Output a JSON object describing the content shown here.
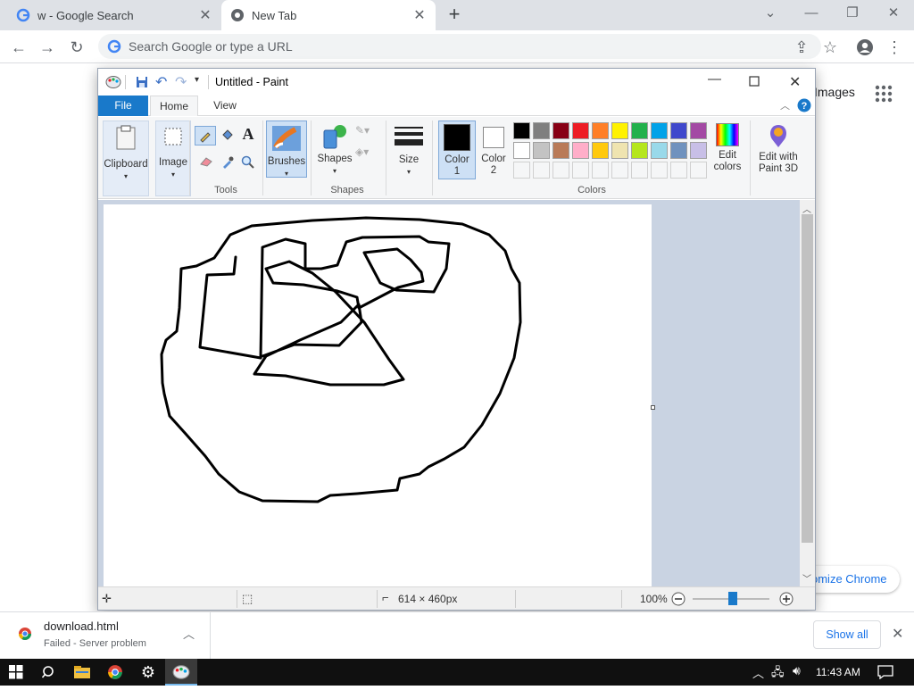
{
  "chrome": {
    "tabs": [
      {
        "title": "w - Google Search",
        "active": false
      },
      {
        "title": "New Tab",
        "active": true
      }
    ],
    "omnibox_placeholder": "Search Google or type a URL",
    "images_link": "Images",
    "customize_label": "Customize Chrome",
    "customize_visible": "omize Chrome"
  },
  "paint": {
    "title": "Untitled - Paint",
    "menu_tabs": [
      "File",
      "Home",
      "View"
    ],
    "ribbon": {
      "clipboard": "Clipboard",
      "image": "Image",
      "tools_group": "Tools",
      "brushes": "Brushes",
      "shapes": "Shapes",
      "shapes_group": "Shapes",
      "size": "Size",
      "color1": "Color 1",
      "color2": "Color 2",
      "colors_group": "Colors",
      "edit_colors": "Edit colors",
      "edit_with_paint3d": "Edit with Paint 3D"
    },
    "palette_row1": [
      "#000000",
      "#7f7f7f",
      "#880015",
      "#ed1c24",
      "#ff7f27",
      "#fff200",
      "#22b14c",
      "#00a2e8",
      "#3f48cc",
      "#a349a4"
    ],
    "palette_row2": [
      "#ffffff",
      "#c3c3c3",
      "#b97a57",
      "#ffaec9",
      "#ffc90e",
      "#efe4b0",
      "#b5e61d",
      "#99d9ea",
      "#7092be",
      "#c8bfe7"
    ],
    "status": {
      "dimensions": "614 × 460px",
      "zoom": "100%"
    }
  },
  "download": {
    "filename": "download.html",
    "status": "Failed - Server problem",
    "show_all": "Show all"
  },
  "taskbar": {
    "time": "11:43 AM"
  }
}
